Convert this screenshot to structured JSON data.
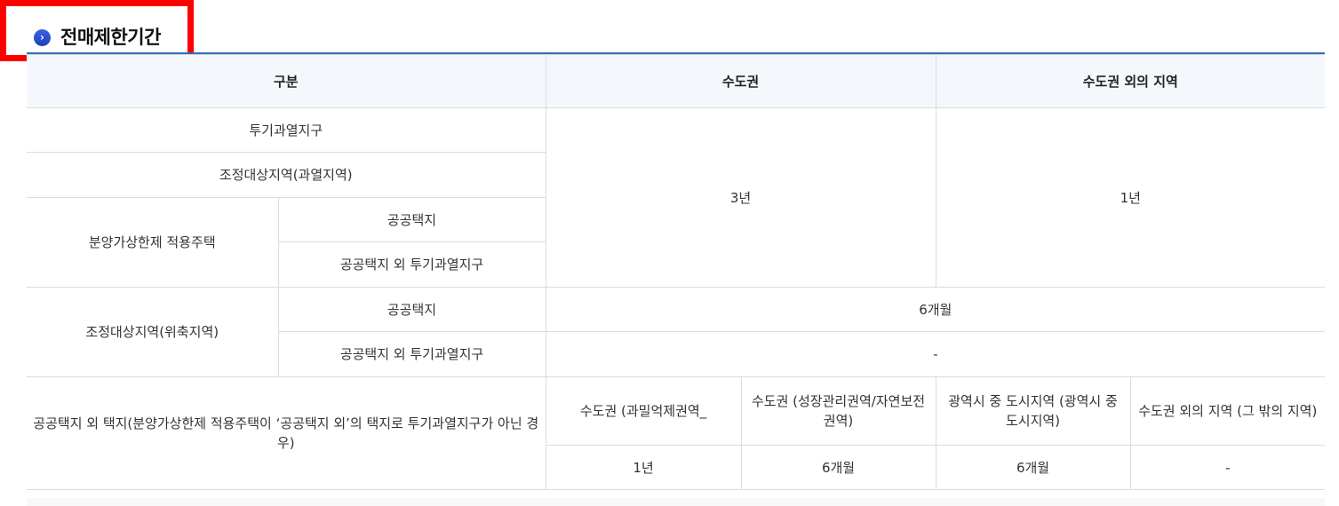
{
  "section": {
    "icon": "chevron-right-icon",
    "icon_glyph": "›",
    "title": "전매제한기간"
  },
  "table": {
    "headers": {
      "category": "구분",
      "capital_area": "수도권",
      "non_capital_area": "수도권 외의 지역"
    },
    "rows": {
      "overheated_district": "투기과열지구",
      "adjustment_overheated": "조정대상지역(과열지역)",
      "price_cap_housing": "분양가상한제 적용주택",
      "price_cap_public_land": "공공택지",
      "price_cap_non_public_overheated": "공공택지 외 투기과열지구",
      "capital_value": "3년",
      "non_capital_value": "1년",
      "adjustment_contraction": "조정대상지역(위축지역)",
      "contraction_public_land": "공공택지",
      "contraction_public_value": "6개월",
      "contraction_non_public": "공공택지 외 투기과열지구",
      "contraction_non_public_value": "-",
      "non_public_land": "공공택지 외 택지(분양가상한제 적용주택이 ‘공공택지 외’의 택지로 투기과열지구가 아닌 경우)"
    },
    "sub_headers": [
      "수도권 (과밀억제권역_",
      "수도권 (성장관리권역/자연보전권역)",
      "광역시 중 도시지역 (광역시 중 도시지역)",
      "수도권 외의 지역 (그 밖의 지역)"
    ],
    "sub_values": [
      "1년",
      "6개월",
      "6개월",
      "-"
    ]
  }
}
